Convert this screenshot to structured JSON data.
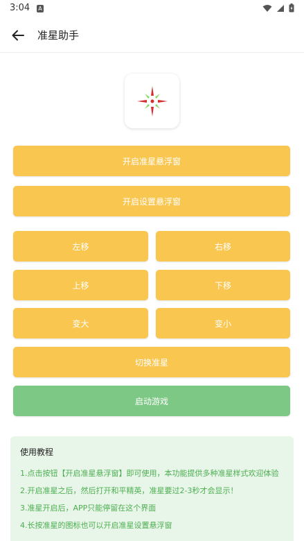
{
  "status_bar": {
    "time": "3:04",
    "notif_icon": "A",
    "icons": [
      "wifi-icon",
      "signal-icon",
      "battery-icon"
    ]
  },
  "app_bar": {
    "title": "准星助手",
    "back_icon": "arrow-left-icon"
  },
  "logo": {
    "icon": "crosshair-icon",
    "colors": {
      "red": "#d32f2f",
      "green": "#7ed957"
    }
  },
  "buttons": {
    "open_crosshair_float": "开启准星悬浮窗",
    "open_settings_float": "开启设置悬浮窗",
    "move_left": "左移",
    "move_right": "右移",
    "move_up": "上移",
    "move_down": "下移",
    "enlarge": "变大",
    "shrink": "变小",
    "switch_crosshair": "切换准星",
    "start_game": "启动游戏"
  },
  "tutorial": {
    "title": "使用教程",
    "items": [
      "1.点击按钮【开启准星悬浮窗】即可使用，本功能提供多种准星样式欢迎体验",
      "2.开启准星之后，然后打开和平精英，准星要过2-3秒才会显示！",
      "3.准星开启后，APP只能停留在这个界面",
      "4.长按准星的图标也可以开启准星设置悬浮窗"
    ]
  },
  "colors": {
    "button_yellow": "#f9c650",
    "button_green": "#7ec885",
    "tutorial_bg": "#e8f5e9",
    "tutorial_text": "#4caf50"
  }
}
